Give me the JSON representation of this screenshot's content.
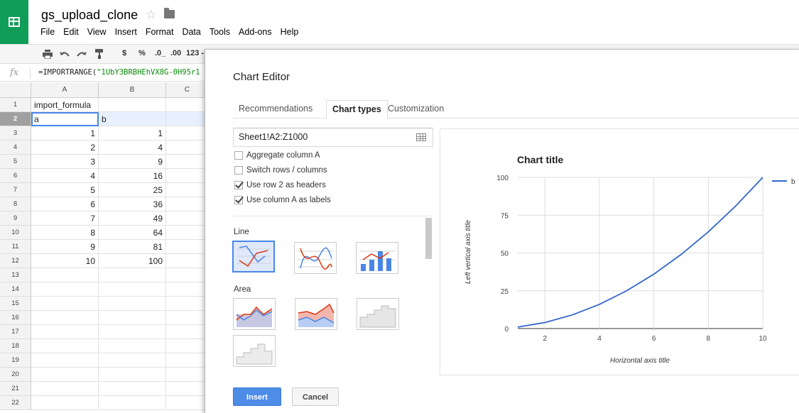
{
  "app": {
    "doc_title": "gs_upload_clone",
    "menu": [
      "File",
      "Edit",
      "View",
      "Insert",
      "Format",
      "Data",
      "Tools",
      "Add-ons",
      "Help"
    ],
    "toolbar": {
      "currency": "$",
      "percent": "%",
      "dec_decrease": ".0_",
      "dec_increase": ".00",
      "format_more": "123 -"
    },
    "formula_bar": {
      "fx": "fx",
      "formula_prefix": "=IMPORTRANGE(",
      "formula_string": "\"1UbY3BRBHEhVX8G-0H95r1"
    },
    "columns": [
      "A",
      "B",
      "C"
    ],
    "rows": [
      {
        "n": "1",
        "a": "import_formula",
        "b": ""
      },
      {
        "n": "2",
        "a": "a",
        "b": "b"
      },
      {
        "n": "3",
        "a": "1",
        "b": "1"
      },
      {
        "n": "4",
        "a": "2",
        "b": "4"
      },
      {
        "n": "5",
        "a": "3",
        "b": "9"
      },
      {
        "n": "6",
        "a": "4",
        "b": "16"
      },
      {
        "n": "7",
        "a": "5",
        "b": "25"
      },
      {
        "n": "8",
        "a": "6",
        "b": "36"
      },
      {
        "n": "9",
        "a": "7",
        "b": "49"
      },
      {
        "n": "10",
        "a": "8",
        "b": "64"
      },
      {
        "n": "11",
        "a": "9",
        "b": "81"
      },
      {
        "n": "12",
        "a": "10",
        "b": "100"
      },
      {
        "n": "13",
        "a": "",
        "b": ""
      },
      {
        "n": "14",
        "a": "",
        "b": ""
      },
      {
        "n": "15",
        "a": "",
        "b": ""
      },
      {
        "n": "16",
        "a": "",
        "b": ""
      },
      {
        "n": "17",
        "a": "",
        "b": ""
      },
      {
        "n": "18",
        "a": "",
        "b": ""
      },
      {
        "n": "19",
        "a": "",
        "b": ""
      },
      {
        "n": "20",
        "a": "",
        "b": ""
      },
      {
        "n": "21",
        "a": "",
        "b": ""
      },
      {
        "n": "22",
        "a": "",
        "b": ""
      }
    ]
  },
  "editor": {
    "title": "Chart Editor",
    "tabs": [
      "Recommendations",
      "Chart types",
      "Customization"
    ],
    "active_tab": "Chart types",
    "range": "Sheet1!A2:Z1000",
    "options": [
      {
        "label": "Aggregate column A",
        "checked": false
      },
      {
        "label": "Switch rows / columns",
        "checked": false
      },
      {
        "label": "Use row 2 as headers",
        "checked": true
      },
      {
        "label": "Use column A as labels",
        "checked": true
      }
    ],
    "sections": {
      "line": "Line",
      "area": "Area"
    },
    "buttons": {
      "insert": "Insert",
      "cancel": "Cancel"
    },
    "colors": {
      "accent": "#4d8de8",
      "series_blue": "#3366cc",
      "series_red": "#dc3912"
    }
  },
  "chart_data": {
    "type": "line",
    "title": "Chart title",
    "xlabel": "Horizontal axis title",
    "ylabel": "Left vertical axis title",
    "x": [
      1,
      2,
      3,
      4,
      5,
      6,
      7,
      8,
      9,
      10
    ],
    "series": [
      {
        "name": "b",
        "values": [
          1,
          4,
          9,
          16,
          25,
          36,
          49,
          64,
          81,
          100
        ],
        "color": "#3366cc"
      }
    ],
    "xticks": [
      2,
      4,
      6,
      8,
      10
    ],
    "yticks": [
      0,
      25,
      50,
      75,
      100
    ],
    "xlim": [
      1,
      10
    ],
    "ylim": [
      0,
      100
    ],
    "grid": true,
    "legend": "right"
  }
}
